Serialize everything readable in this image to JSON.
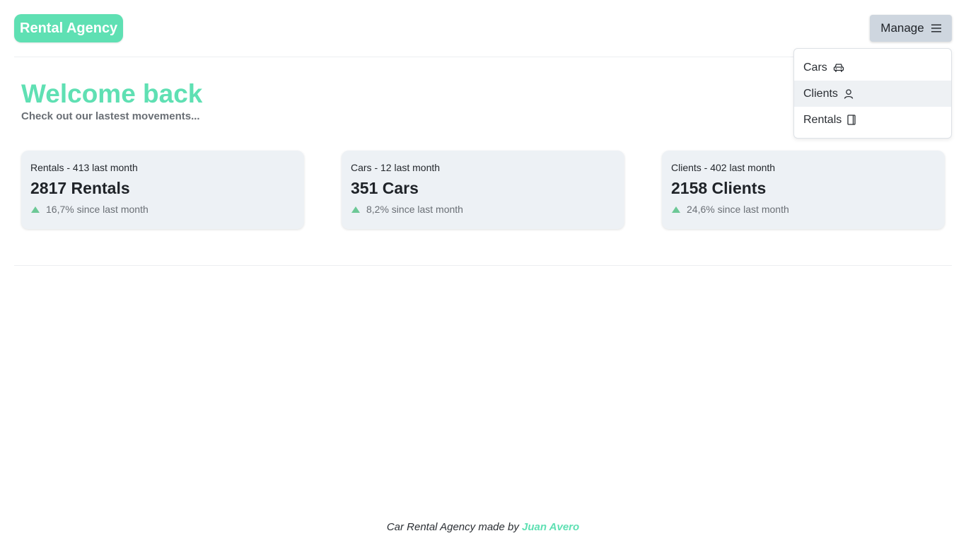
{
  "header": {
    "brand": "Rental Agency",
    "manage_label": "Manage"
  },
  "menu": {
    "items": [
      {
        "label": "Cars",
        "icon": "car-icon"
      },
      {
        "label": "Clients",
        "icon": "user-icon"
      },
      {
        "label": "Rentals",
        "icon": "book-icon"
      }
    ],
    "highlighted": "Clients"
  },
  "welcome": {
    "title": "Welcome back",
    "subtitle": "Check out our lastest movements..."
  },
  "cards": [
    {
      "label": "Rentals - 413 last month",
      "value": "2817 Rentals",
      "trend": "16,7% since last month"
    },
    {
      "label": "Cars - 12 last month",
      "value": "351 Cars",
      "trend": "8,2% since last month"
    },
    {
      "label": "Clients - 402 last month",
      "value": "2158 Clients",
      "trend": "24,6% since last month"
    }
  ],
  "footer": {
    "text": "Car Rental Agency made by",
    "author": "Juan Avero"
  },
  "colors": {
    "brand": "#5fe0b3",
    "trend_up": "#6cc896",
    "card_bg": "#edf1f5",
    "button_bg": "#ced6df"
  }
}
